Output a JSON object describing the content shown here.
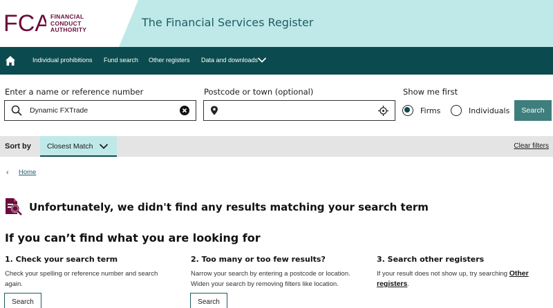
{
  "header": {
    "logo_letters": "FCA",
    "logo_lines": [
      "FINANCIAL",
      "CONDUCT",
      "AUTHORITY"
    ],
    "title": "The Financial Services Register"
  },
  "nav": {
    "items": [
      "Individual prohibitions",
      "Fund search",
      "Other registers",
      "Data and downloads"
    ]
  },
  "search": {
    "name_label": "Enter a name or reference number",
    "name_value": "Dynamic FXTrade",
    "location_label": "Postcode or town (optional)",
    "location_value": "",
    "show_first_label": "Show me first",
    "options": [
      "Firms",
      "Individuals"
    ],
    "selected": "Firms",
    "button": "Search"
  },
  "sort": {
    "label": "Sort by",
    "value": "Closest Match",
    "clear_filters": "Clear filters"
  },
  "breadcrumb": {
    "home": "Home"
  },
  "results": {
    "no_results": "Unfortunately, we didn't find any results matching your search term",
    "help_title": "If you can’t find what you are looking for",
    "columns": [
      {
        "title": "1. Check your search term",
        "text": "Check your spelling or reference number and search again.",
        "button": "Search"
      },
      {
        "title": "2. Too many or too few results?",
        "text": "Narrow your search by entering a postcode or location. Widen your search by removing filters like location.",
        "button": "Search"
      },
      {
        "title": "3. Search other registers",
        "text": "If your result does not show up, try searching ",
        "link": "Other registers",
        "suffix": "."
      }
    ]
  },
  "colors": {
    "header_bg": "#bfe9e8",
    "nav_bg": "#0b4b4f",
    "brand": "#6a0d3c",
    "button_bg": "#3e7f7e"
  }
}
